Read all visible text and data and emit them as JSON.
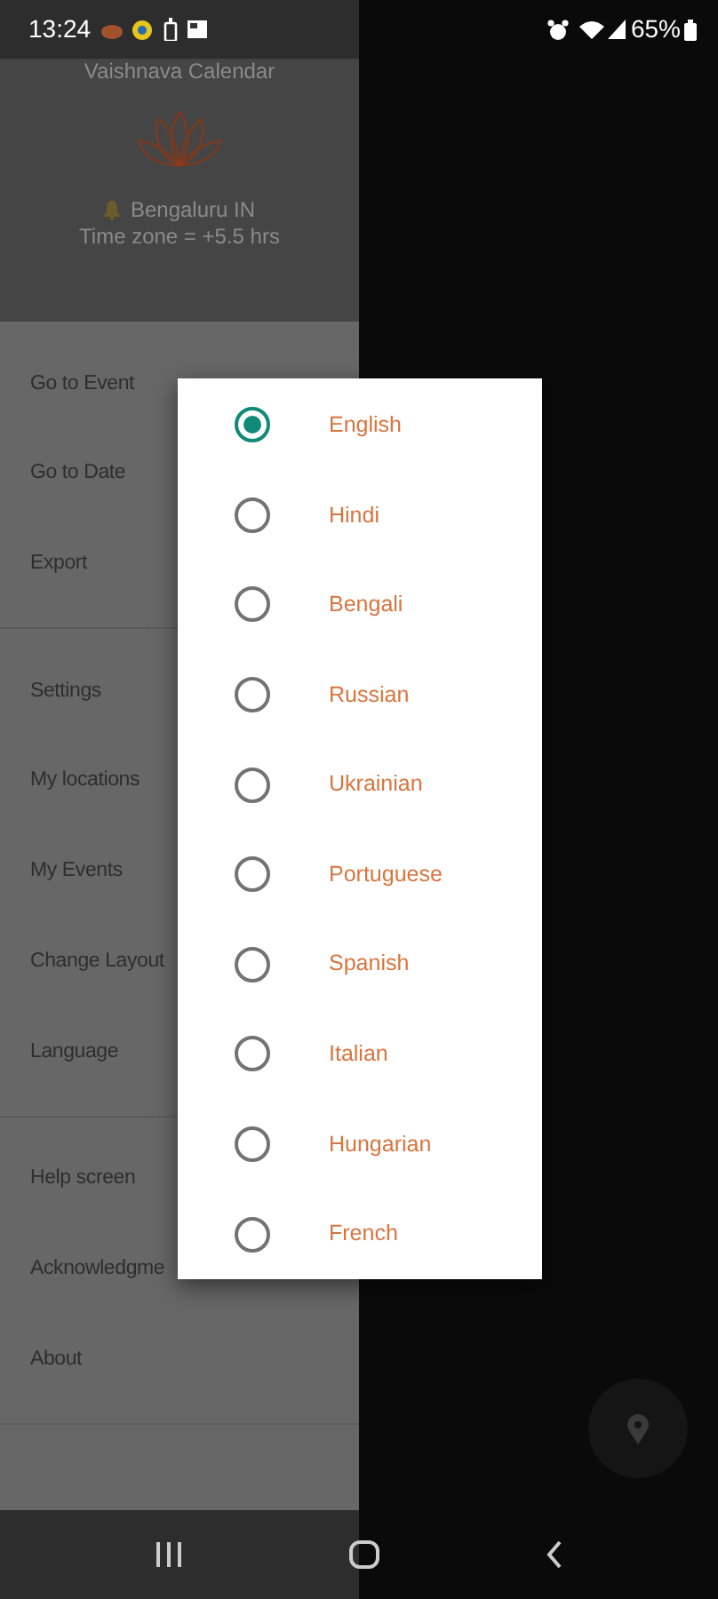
{
  "status_bar": {
    "time": "13:24",
    "battery": "65%"
  },
  "drawer": {
    "header": {
      "title": "Vaishnava Calendar",
      "location": "Bengaluru IN",
      "timezone": "Time zone = +5.5 hrs"
    },
    "groups": [
      {
        "items": [
          "Go to Event",
          "Go to Date",
          "Export"
        ]
      },
      {
        "items": [
          "Settings",
          "My locations",
          "My Events",
          "Change Layout",
          "Language"
        ]
      },
      {
        "items": [
          "Help screen",
          "Acknowledgme",
          "About"
        ]
      }
    ]
  },
  "dialog": {
    "options": [
      {
        "label": "English",
        "selected": true
      },
      {
        "label": "Hindi",
        "selected": false
      },
      {
        "label": "Bengali",
        "selected": false
      },
      {
        "label": "Russian",
        "selected": false
      },
      {
        "label": "Ukrainian",
        "selected": false
      },
      {
        "label": "Portuguese",
        "selected": false
      },
      {
        "label": "Spanish",
        "selected": false
      },
      {
        "label": "Italian",
        "selected": false
      },
      {
        "label": "Hungarian",
        "selected": false
      },
      {
        "label": "French",
        "selected": false
      }
    ]
  }
}
